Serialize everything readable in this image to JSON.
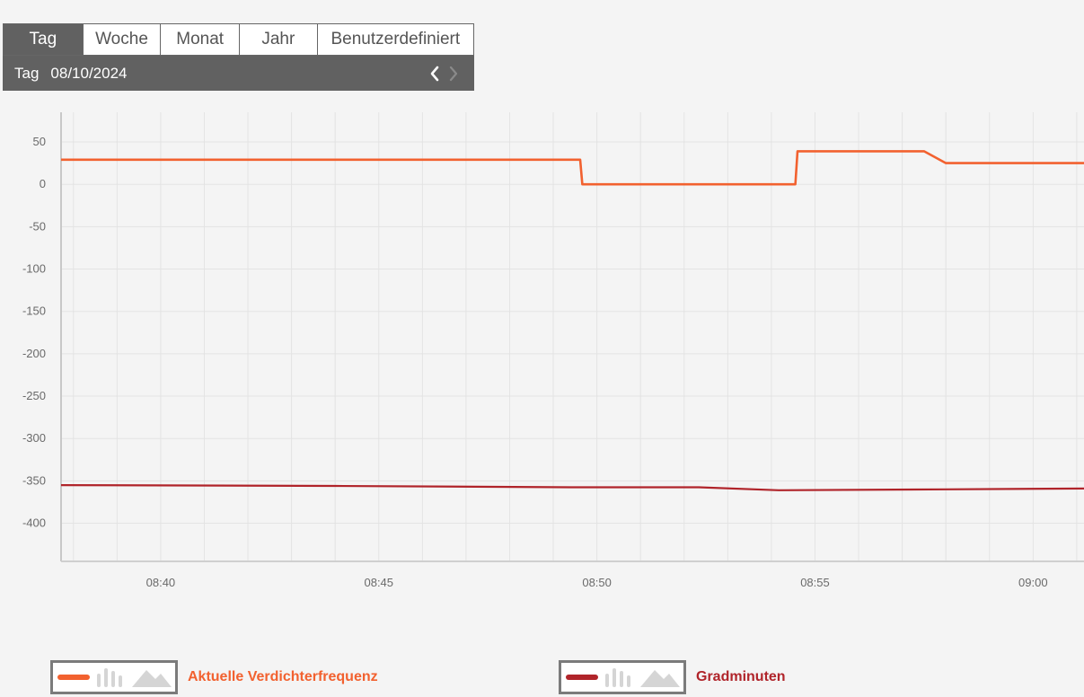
{
  "tabs": [
    {
      "label": "Tag",
      "active": true
    },
    {
      "label": "Woche",
      "active": false
    },
    {
      "label": "Monat",
      "active": false
    },
    {
      "label": "Jahr",
      "active": false
    },
    {
      "label": "Benutzerdefiniert",
      "active": false
    }
  ],
  "period": {
    "label": "Tag",
    "date": "08/10/2024"
  },
  "icons": {
    "prev": "chevron-left-icon",
    "next": "chevron-right-icon"
  },
  "colors": {
    "series1": "#f2612f",
    "series2": "#b0242a",
    "panel_bg": "#616161",
    "grid": "#e2e2e2"
  },
  "chart_data": {
    "type": "line",
    "ylim": [
      -445,
      85
    ],
    "yticks": [
      50,
      0,
      -50,
      -100,
      -150,
      -200,
      -250,
      -300,
      -350,
      -400
    ],
    "xlim": [
      "08:37:43",
      "09:01:10"
    ],
    "xticks": [
      "08:40",
      "08:45",
      "08:50",
      "08:55",
      "09:00"
    ],
    "grid": true,
    "legend_position": "bottom",
    "series": [
      {
        "name": "Aktuelle Verdichterfrequenz",
        "color": "#f2612f",
        "points": [
          [
            "08:37:43",
            29
          ],
          [
            "08:49:37",
            29
          ],
          [
            "08:49:40",
            0
          ],
          [
            "08:54:33",
            0
          ],
          [
            "08:54:36",
            39
          ],
          [
            "08:57:30",
            39
          ],
          [
            "08:58:00",
            25
          ],
          [
            "09:01:10",
            25
          ]
        ]
      },
      {
        "name": "Gradminuten",
        "color": "#b0242a",
        "points": [
          [
            "08:37:43",
            -355
          ],
          [
            "08:44:00",
            -356
          ],
          [
            "08:49:30",
            -357.5
          ],
          [
            "08:52:20",
            -357.5
          ],
          [
            "08:54:10",
            -361
          ],
          [
            "08:58:00",
            -360
          ],
          [
            "09:01:10",
            -359
          ]
        ]
      }
    ]
  }
}
